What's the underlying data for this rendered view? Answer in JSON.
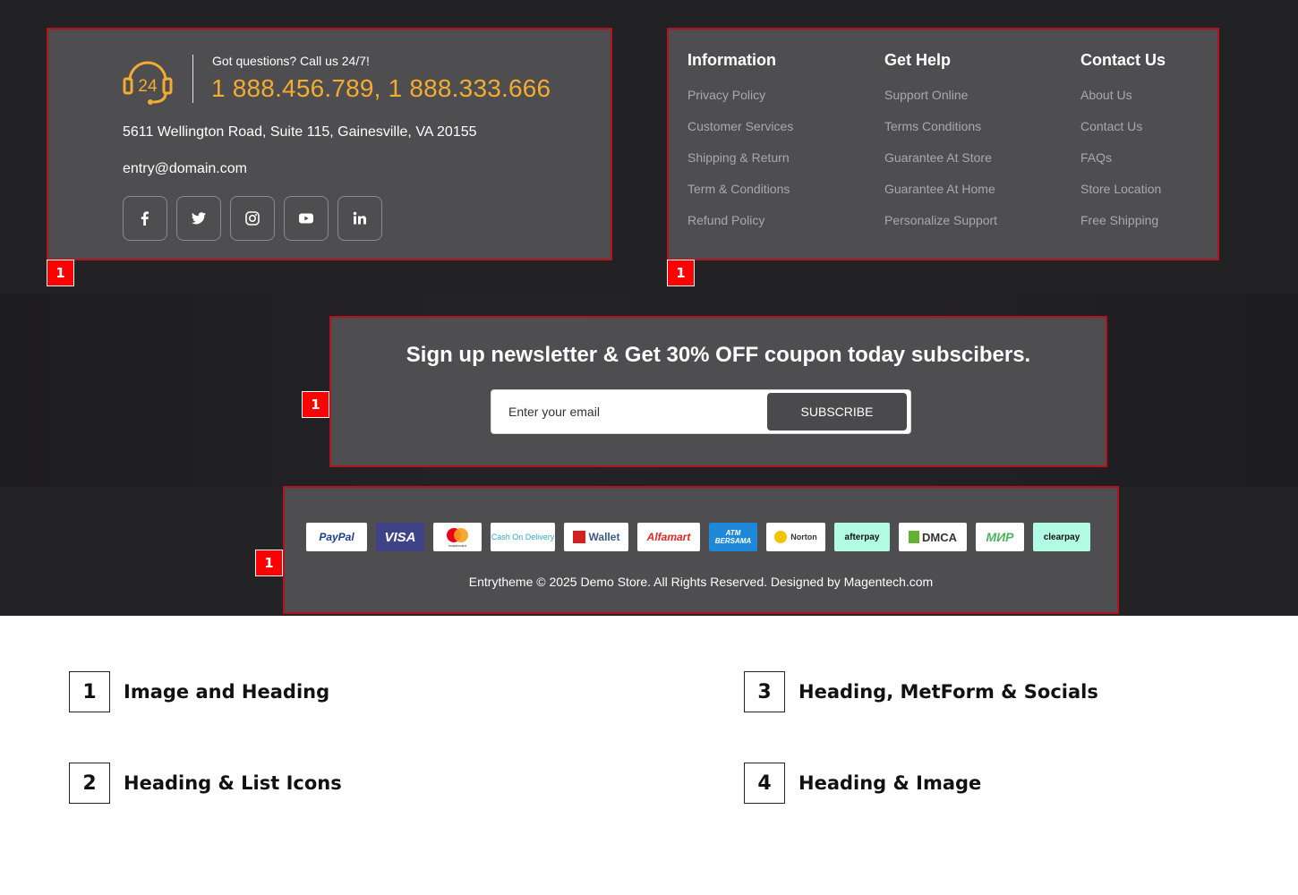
{
  "contact": {
    "question": "Got questions? Call us 24/7!",
    "phones": "1 888.456.789, 1 888.333.666",
    "address": "5611 Wellington Road, Suite 115, Gainesville, VA 20155",
    "email": "entry@domain.com",
    "support_icon_text": "24",
    "socials": [
      "facebook-icon",
      "twitter-icon",
      "instagram-icon",
      "youtube-icon",
      "linkedin-icon"
    ]
  },
  "links": {
    "columns": [
      {
        "title": "Information",
        "items": [
          "Privacy Policy",
          "Customer Services",
          "Shipping & Return",
          "Term & Conditions",
          "Refund Policy"
        ]
      },
      {
        "title": "Get Help",
        "items": [
          "Support Online",
          "Terms Conditions",
          "Guarantee At Store",
          "Guarantee At Home",
          "Personalize Support"
        ]
      },
      {
        "title": "Contact Us",
        "items": [
          "About Us",
          "Contact Us",
          "FAQs",
          "Store Location",
          "Free Shipping"
        ]
      }
    ]
  },
  "newsletter": {
    "title": "Sign up newsletter & Get 30% OFF coupon today subscibers.",
    "placeholder": "Enter your email",
    "button": "SUBSCRIBE"
  },
  "footer": {
    "payments": [
      "PayPal",
      "VISA",
      "mastercard",
      "Cash On Delivery",
      "Wallet",
      "Alfamart",
      "ATM BERSAMA",
      "Norton",
      "afterpay",
      "DMCA",
      "МИР",
      "clearpay"
    ],
    "copyright": "Entrytheme © 2025 Demo Store. All Rights Reserved. Designed by Magentech.com"
  },
  "markers": [
    "1",
    "1",
    "1",
    "1"
  ],
  "legend": [
    {
      "num": "1",
      "label": "Image and Heading"
    },
    {
      "num": "2",
      "label": "Heading & List Icons"
    },
    {
      "num": "3",
      "label": "Heading, MetForm & Socials"
    },
    {
      "num": "4",
      "label": "Heading & Image"
    }
  ],
  "colors": {
    "accent": "#f4ab32",
    "panel": "#4e4d4f",
    "border": "#b3131b",
    "marker": "#ff0000"
  }
}
